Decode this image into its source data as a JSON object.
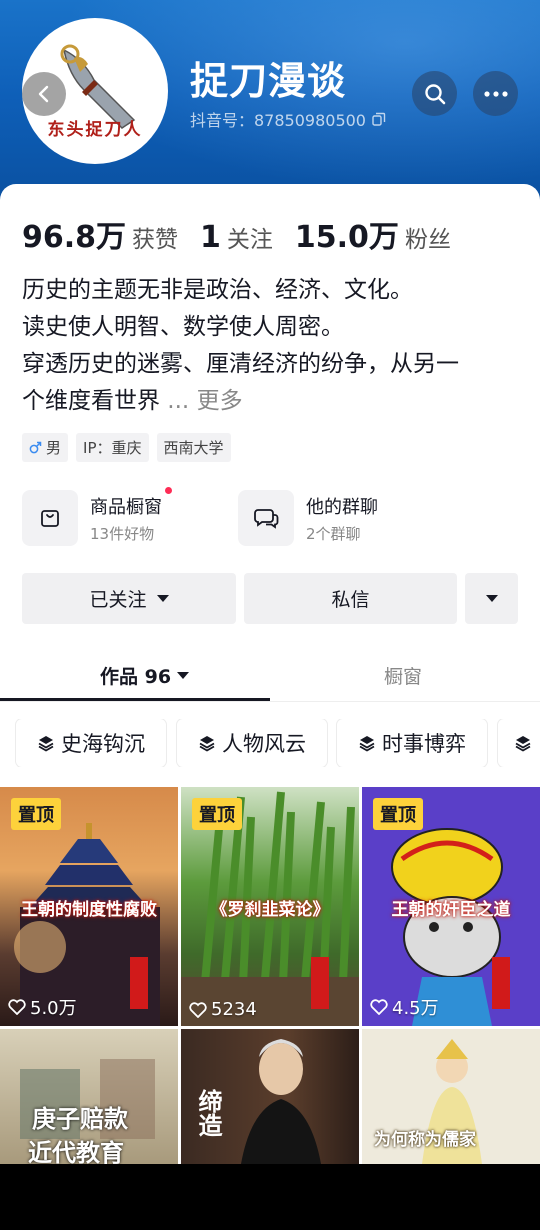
{
  "profile": {
    "name": "捉刀漫谈",
    "douyin_id": "抖音号：87850980500",
    "avatar_caption": "东头捉刀人"
  },
  "stats": {
    "likes": "96.8万",
    "likes_label": "获赞",
    "following": "1",
    "following_label": "关注",
    "followers": "15.0万",
    "followers_label": "粉丝"
  },
  "bio": {
    "lines": [
      "历史的主题无非是政治、经济、文化。",
      "读史使人明智、数学使人周密。",
      "穿透历史的迷雾、厘清经济的纷争，从另一",
      "个维度看世界"
    ],
    "ellipsis": " ... ",
    "more_label": "更多"
  },
  "tags": [
    "男",
    "IP：重庆",
    "西南大学"
  ],
  "quick": {
    "shop_title": "商品橱窗",
    "shop_sub": "13件好物",
    "group_title": "他的群聊",
    "group_sub": "2个群聊"
  },
  "actions": {
    "followed": "已关注",
    "message": "私信"
  },
  "tabs": [
    {
      "label": "作品 96"
    },
    {
      "label": "橱窗"
    }
  ],
  "collections": [
    "史海钩沉",
    "人物风云",
    "时事博弈"
  ],
  "grid": [
    {
      "badge": "置顶",
      "title": "王朝的制度性腐败",
      "likes": "5.0万"
    },
    {
      "badge": "置顶",
      "title": "《罗刹韭菜论》",
      "likes": "5234"
    },
    {
      "badge": "置顶",
      "title": "王朝的奸臣之道",
      "likes": "4.5万"
    },
    {
      "title": "庚子赔款",
      "subtitle": "近代教育"
    },
    {
      "title": "缔造"
    },
    {
      "title": "为何称为儒家"
    }
  ],
  "colors": {
    "banner": "#1a73c9",
    "pin_badge": "#fdd23b",
    "notification_dot": "#fe2c55"
  }
}
